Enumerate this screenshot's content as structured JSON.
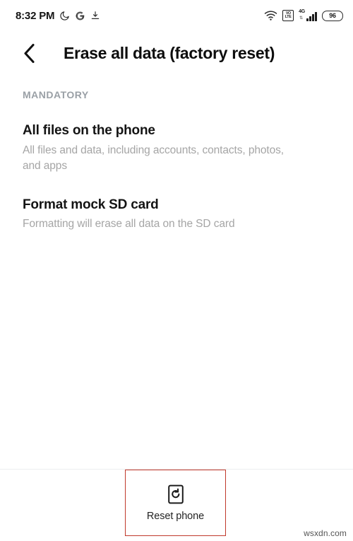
{
  "status_bar": {
    "time": "8:32 PM",
    "icons_left": [
      {
        "name": "do-not-disturb-moon-icon",
        "glyph": "moon"
      },
      {
        "name": "google-g-icon",
        "glyph": "G"
      },
      {
        "name": "download-icon",
        "glyph": "download"
      }
    ],
    "wifi_label": "wifi-icon",
    "volte_line1": "VO",
    "volte_line2": "LTE",
    "network_type": "4G",
    "data_arrows": "⇅",
    "battery_level": "96"
  },
  "header": {
    "back_label": "back-button",
    "title": "Erase all data (factory reset)"
  },
  "main": {
    "section_label": "MANDATORY",
    "items": [
      {
        "title": "All files on the phone",
        "subtitle": "All files and data, including accounts, contacts, photos, and apps"
      },
      {
        "title": "Format mock SD card",
        "subtitle": "Formatting will erase all data on the SD card"
      }
    ]
  },
  "bottom_bar": {
    "reset_label": "Reset phone",
    "reset_icon": "phone-reset-icon"
  },
  "annotation": {
    "box_color": "#c0392b"
  },
  "watermark": {
    "text": "wsxdn.com"
  }
}
